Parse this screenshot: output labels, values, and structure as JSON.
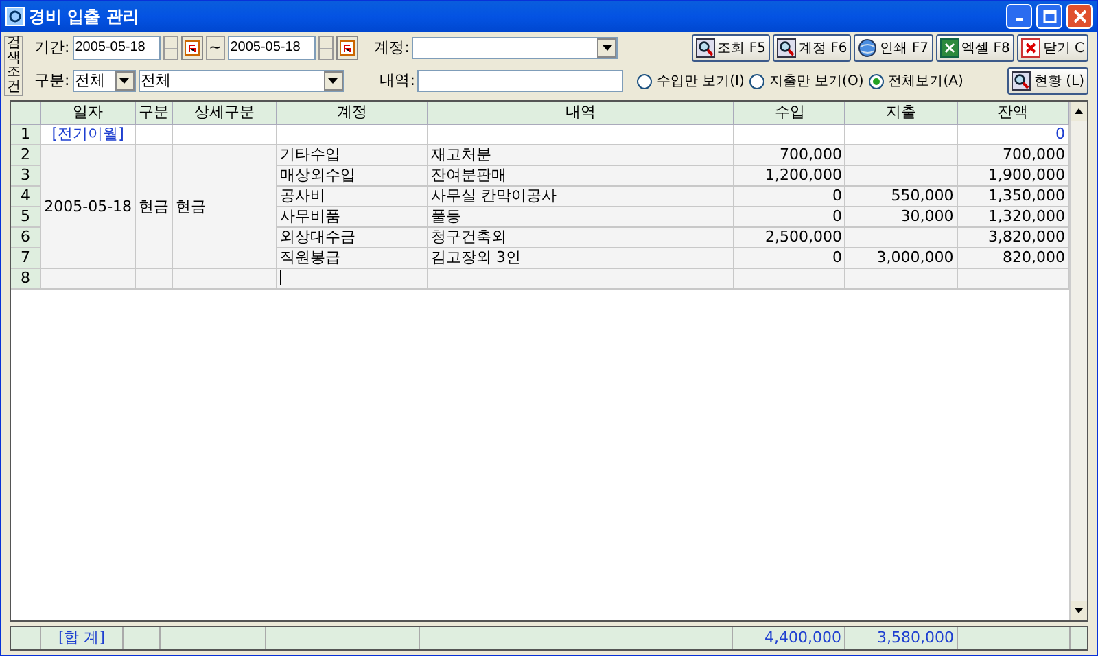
{
  "window": {
    "title": "경비 입출 관리"
  },
  "filter": {
    "side_label": "검색조건",
    "period_label": "기간:",
    "date_from": "2005-05-18",
    "tilde": "~",
    "date_to": "2005-05-18",
    "account_label": "계정:",
    "type_label": "구분:",
    "type_value": "전체",
    "detail_value": "전체",
    "memo_label": "내역:"
  },
  "buttons": [
    {
      "label": "조회 F5",
      "kind": "search"
    },
    {
      "label": "계정 F6",
      "kind": "search"
    },
    {
      "label": "인쇄 F7",
      "kind": "print"
    },
    {
      "label": "엑셀 F8",
      "kind": "excel"
    },
    {
      "label": "닫기 C",
      "kind": "close"
    }
  ],
  "view_options": [
    {
      "label": "수입만 보기(I)",
      "selected": false
    },
    {
      "label": "지출만 보기(O)",
      "selected": false
    },
    {
      "label": "전체보기(A)",
      "selected": true
    }
  ],
  "status_button": "현황 (L)",
  "table": {
    "columns": [
      "일자",
      "구분",
      "상세구분",
      "계정",
      "내역",
      "수입",
      "지출",
      "잔액"
    ],
    "carry_row": {
      "num": "1",
      "label": "[전기이월]",
      "balance": "0"
    },
    "group": {
      "date": "2005-05-18",
      "type": "현금",
      "detail": "현금"
    },
    "rows": [
      {
        "num": "2",
        "account": "기타수입",
        "memo": "재고처분",
        "income": "700,000",
        "expense": "",
        "balance": "700,000"
      },
      {
        "num": "3",
        "account": "매상외수입",
        "memo": "잔여분판매",
        "income": "1,200,000",
        "expense": "",
        "balance": "1,900,000"
      },
      {
        "num": "4",
        "account": "공사비",
        "memo": "사무실 칸막이공사",
        "income": "0",
        "expense": "550,000",
        "balance": "1,350,000"
      },
      {
        "num": "5",
        "account": "사무비품",
        "memo": "풀등",
        "income": "0",
        "expense": "30,000",
        "balance": "1,320,000"
      },
      {
        "num": "6",
        "account": "외상대수금",
        "memo": "청구건축외",
        "income": "2,500,000",
        "expense": "",
        "balance": "3,820,000"
      },
      {
        "num": "7",
        "account": "직원봉급",
        "memo": "김고장외 3인",
        "income": "0",
        "expense": "3,000,000",
        "balance": "820,000"
      }
    ],
    "new_row": {
      "num": "8"
    },
    "totals": {
      "label": "[합 계]",
      "income": "4,400,000",
      "expense": "3,580,000"
    }
  }
}
